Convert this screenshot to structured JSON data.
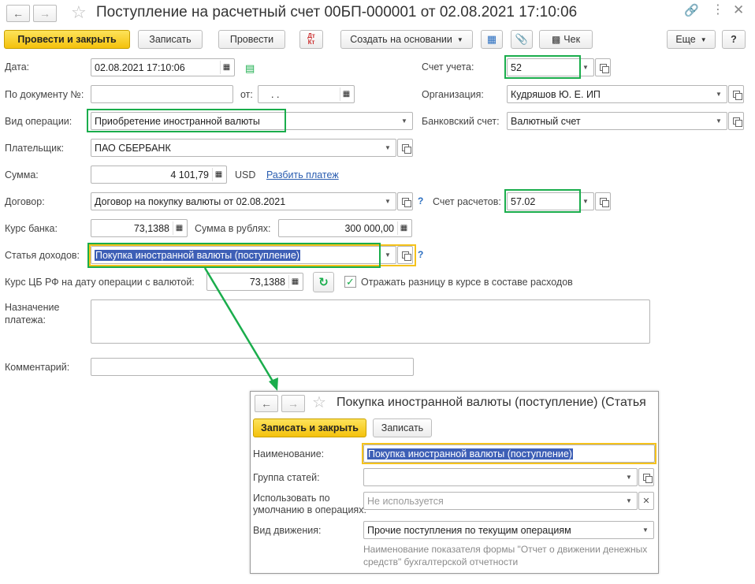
{
  "window": {
    "title": "Поступление на расчетный счет 00БП-000001 от 02.08.2021 17:10:06"
  },
  "toolbar": {
    "post_close": "Провести и закрыть",
    "save": "Записать",
    "post": "Провести",
    "dt_kt": "Дт\nКт",
    "create_based": "Создать на основании",
    "receipt": "Чек",
    "more": "Еще",
    "help": "?"
  },
  "form": {
    "date_label": "Дата:",
    "date_value": "02.08.2021 17:10:06",
    "doc_num_label": "По документу №:",
    "doc_num_value": "",
    "from_label": "от:",
    "from_value": " .  .",
    "op_type_label": "Вид операции:",
    "op_type_value": "Приобретение иностранной валюты",
    "payer_label": "Плательщик:",
    "payer_value": "ПАО СБЕРБАНК",
    "amount_label": "Сумма:",
    "amount_value": "4 101,79",
    "currency": "USD",
    "split_link": "Разбить платеж",
    "contract_label": "Договор:",
    "contract_value": "Договор на покупку валюты от 02.08.2021",
    "bank_rate_label": "Курс банка:",
    "bank_rate_value": "73,1388",
    "rub_sum_label": "Сумма в рублях:",
    "rub_sum_value": "300 000,00",
    "income_item_label": "Статья доходов:",
    "income_item_value": "Покупка иностранной валюты (поступление)",
    "cbr_rate_label": "Курс ЦБ РФ на дату операции с валютой:",
    "cbr_rate_value": "73,1388",
    "reflect_diff_label": "Отражать разницу в курсе в составе расходов",
    "reflect_diff_checked": true,
    "purpose_label_1": "Назначение",
    "purpose_label_2": "платежа:",
    "purpose_value": "",
    "comment_label": "Комментарий:",
    "comment_value": "",
    "account_label": "Счет учета:",
    "account_value": "52",
    "org_label": "Организация:",
    "org_value": "Кудряшов Ю. Е. ИП",
    "bank_acc_label": "Банковский счет:",
    "bank_acc_value": "Валютный счет",
    "settle_label": "Счет расчетов:",
    "settle_value": "57.02"
  },
  "subform": {
    "title": "Покупка иностранной валюты (поступление) (Статья",
    "save_close": "Записать и закрыть",
    "save": "Записать",
    "name_label": "Наименование:",
    "name_value": "Покупка иностранной валюты (поступление)",
    "group_label": "Группа статей:",
    "group_value": "",
    "default_label_1": "Использовать по",
    "default_label_2": "умолчанию в операциях:",
    "default_value": "Не используется",
    "movement_label": "Вид движения:",
    "movement_value": "Прочие поступления по текущим операциям",
    "hint_1": "Наименование показателя формы \"Отчет о движении денежных",
    "hint_2": "средств\" бухгалтерской отчетности"
  },
  "colors": {
    "highlight_green": "#1aad4c",
    "highlight_yellow": "#f5c21b",
    "primary_button": "#f4c10c",
    "selection": "#3d5fb6",
    "link": "#2a5db0"
  }
}
